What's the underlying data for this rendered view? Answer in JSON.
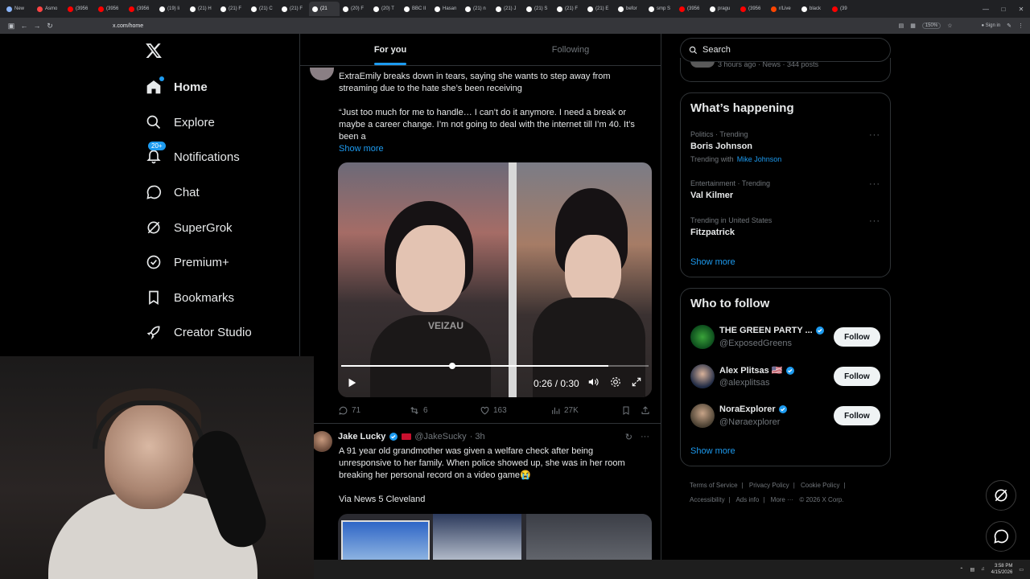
{
  "browser": {
    "tabs": [
      {
        "label": "New",
        "color": "#8ab4f8"
      },
      {
        "label": "Asmo",
        "color": "#ff4444"
      },
      {
        "label": "(3956",
        "color": "#ff0000"
      },
      {
        "label": "(3956",
        "color": "#ff0000"
      },
      {
        "label": "(3956",
        "color": "#ff0000"
      },
      {
        "label": "(19) li",
        "color": "#ffffff"
      },
      {
        "label": "(21) H",
        "color": "#ffffff"
      },
      {
        "label": "(21) F",
        "color": "#ffffff"
      },
      {
        "label": "(21) C",
        "color": "#ffffff"
      },
      {
        "label": "(21) F",
        "color": "#ffffff"
      },
      {
        "label": "(21",
        "color": "#ffffff",
        "active": true
      },
      {
        "label": "(20) F",
        "color": "#ffffff"
      },
      {
        "label": "(20) T",
        "color": "#ffffff"
      },
      {
        "label": "BBC II",
        "color": "#ffffff"
      },
      {
        "label": "Hasan",
        "color": "#ffffff"
      },
      {
        "label": "(21) n",
        "color": "#ffffff"
      },
      {
        "label": "(21) J",
        "color": "#ffffff"
      },
      {
        "label": "(21) S",
        "color": "#ffffff"
      },
      {
        "label": "(21) F",
        "color": "#ffffff"
      },
      {
        "label": "(21) E",
        "color": "#ffffff"
      },
      {
        "label": "befor",
        "color": "#ffffff"
      },
      {
        "label": "smp S",
        "color": "#ffffff"
      },
      {
        "label": "(3956",
        "color": "#ff0000"
      },
      {
        "label": "pragu",
        "color": "#ffffff"
      },
      {
        "label": "(3956",
        "color": "#ff0000"
      },
      {
        "label": "r/Live",
        "color": "#ff4500"
      },
      {
        "label": "black",
        "color": "#ffffff"
      },
      {
        "label": "(39",
        "color": "#ff0000"
      }
    ],
    "url": "x.com/home",
    "zoom": "150%",
    "signin_label": "Sign in"
  },
  "nav": {
    "home": "Home",
    "explore": "Explore",
    "notifications": "Notifications",
    "notifications_badge": "20+",
    "chat": "Chat",
    "supergrok": "SuperGrok",
    "premium": "Premium+",
    "bookmarks": "Bookmarks",
    "creator_studio": "Creator Studio"
  },
  "timeline": {
    "tab_for_you": "For you",
    "tab_following": "Following",
    "tweet1": {
      "text_line1": "ExtraEmily breaks down in tears, saying she wants to step away from",
      "text_line2": "streaming due to the hate she’s been receiving",
      "quote_line1": "“Just too much for me to handle… I can’t do it anymore. I need a break or",
      "quote_line2": "maybe a career change. I’m not going to deal with the internet till I’m 40. It’s",
      "quote_line3": "been a",
      "show_more": "Show more",
      "video_watermark": "VEIZAU",
      "video_time": "0:26 / 0:30",
      "video_progress": 0.87,
      "replies": "71",
      "reposts": "6",
      "likes": "163",
      "views": "27K"
    },
    "tweet2": {
      "name": "Jake Lucky",
      "handle": "@JakeSucky",
      "time": "· 3h",
      "line1": "A 91 year old grandmother was given a welfare check after being",
      "line2": "unresponsive to her family. When police showed up, she was in her room",
      "line3": "breaking her personal record on a video game😭",
      "line4": "Via News 5 Cleveland"
    }
  },
  "sidebar": {
    "search_placeholder": "Search",
    "top_card_meta": "3 hours ago · News · 344 posts",
    "happening_title": "What’s happening",
    "trends": [
      {
        "meta": "Politics · Trending",
        "name": "Boris Johnson",
        "with_label": "Trending with",
        "with_link": "Mike Johnson"
      },
      {
        "meta": "Entertainment · Trending",
        "name": "Val Kilmer"
      },
      {
        "meta": "Trending in United States",
        "name": "Fitzpatrick"
      }
    ],
    "trends_show_more": "Show more",
    "wtf_title": "Who to follow",
    "wtf": [
      {
        "name": "THE GREEN PARTY ...",
        "handle": "@ExposedGreens",
        "button": "Follow"
      },
      {
        "name": "Alex Plitsas 🇺🇸",
        "handle": "@alexplitsas",
        "button": "Follow"
      },
      {
        "name": "NoraExplorer",
        "handle": "@Nøraexplorer",
        "button": "Follow"
      }
    ],
    "wtf_show_more": "Show more",
    "footer": [
      "Terms of Service",
      "|",
      "Privacy Policy",
      "|",
      "Cookie Policy",
      "|",
      "Accessibility",
      "|",
      "Ads info",
      "|",
      "More ···",
      "© 2026 X Corp."
    ]
  },
  "taskbar": {
    "time": "3:58 PM",
    "date": "4/15/2026"
  },
  "colors": {
    "accent": "#1d9bf0",
    "background": "#000000",
    "border": "#2f3336"
  }
}
